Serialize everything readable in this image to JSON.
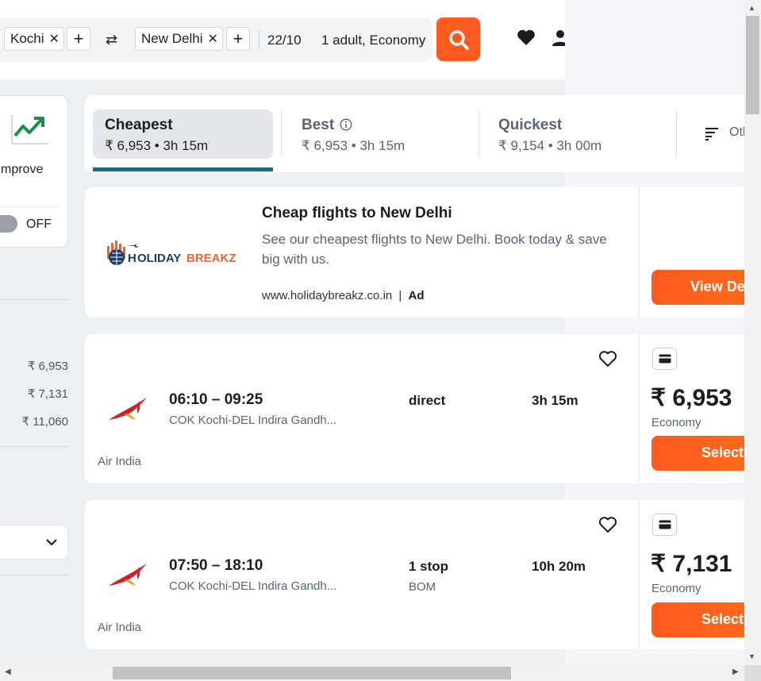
{
  "header": {
    "origin": "Kochi",
    "destination": "New Delhi",
    "date": "22/10",
    "travellers": "1 adult, Economy",
    "remove_symbol": "✕",
    "add_symbol": "+",
    "swap_symbol": "⇄"
  },
  "sidebar": {
    "alert_text": "mprove",
    "toggle_label": "OFF",
    "prices": [
      "₹ 6,953",
      "₹ 7,131",
      "₹ 11,060"
    ]
  },
  "tabs": [
    {
      "title": "Cheapest",
      "sub": "₹ 6,953 • 3h 15m"
    },
    {
      "title": "Best",
      "sub": "₹ 6,953 • 3h 15m"
    },
    {
      "title": "Quickest",
      "sub": "₹ 9,154 • 3h 00m"
    },
    {
      "title": "Oth"
    }
  ],
  "ad": {
    "logo_text": "HOLIDAYBREAKZ",
    "title": "Cheap flights to New Delhi",
    "description": "See our cheapest flights to New Delhi. Book today & save big with us.",
    "url": "www.holidaybreakz.co.in",
    "separator": "|",
    "tag": "Ad",
    "button": "View Deal"
  },
  "flights": [
    {
      "times": "06:10 – 09:25",
      "route": "COK Kochi-DEL Indira Gandh...",
      "stops": "direct",
      "via": "",
      "duration": "3h 15m",
      "airline": "Air India",
      "price": "₹ 6,953",
      "cabin": "Economy",
      "button": "Select"
    },
    {
      "times": "07:50 – 18:10",
      "route": "COK Kochi-DEL Indira Gandh...",
      "stops": "1 stop",
      "via": "BOM",
      "duration": "10h 20m",
      "airline": "Air India",
      "price": "₹ 7,131",
      "cabin": "Economy",
      "button": "Select"
    }
  ],
  "colors": {
    "accent": "#ff5a1f",
    "tab_underline": "#0a6e8e",
    "trend_green": "#1e8a4c"
  },
  "icons": [
    "search-icon",
    "heart-icon",
    "user-icon",
    "trend-icon",
    "filter-icon",
    "info-icon",
    "card-icon",
    "chevron-down-icon",
    "airline-logo"
  ]
}
